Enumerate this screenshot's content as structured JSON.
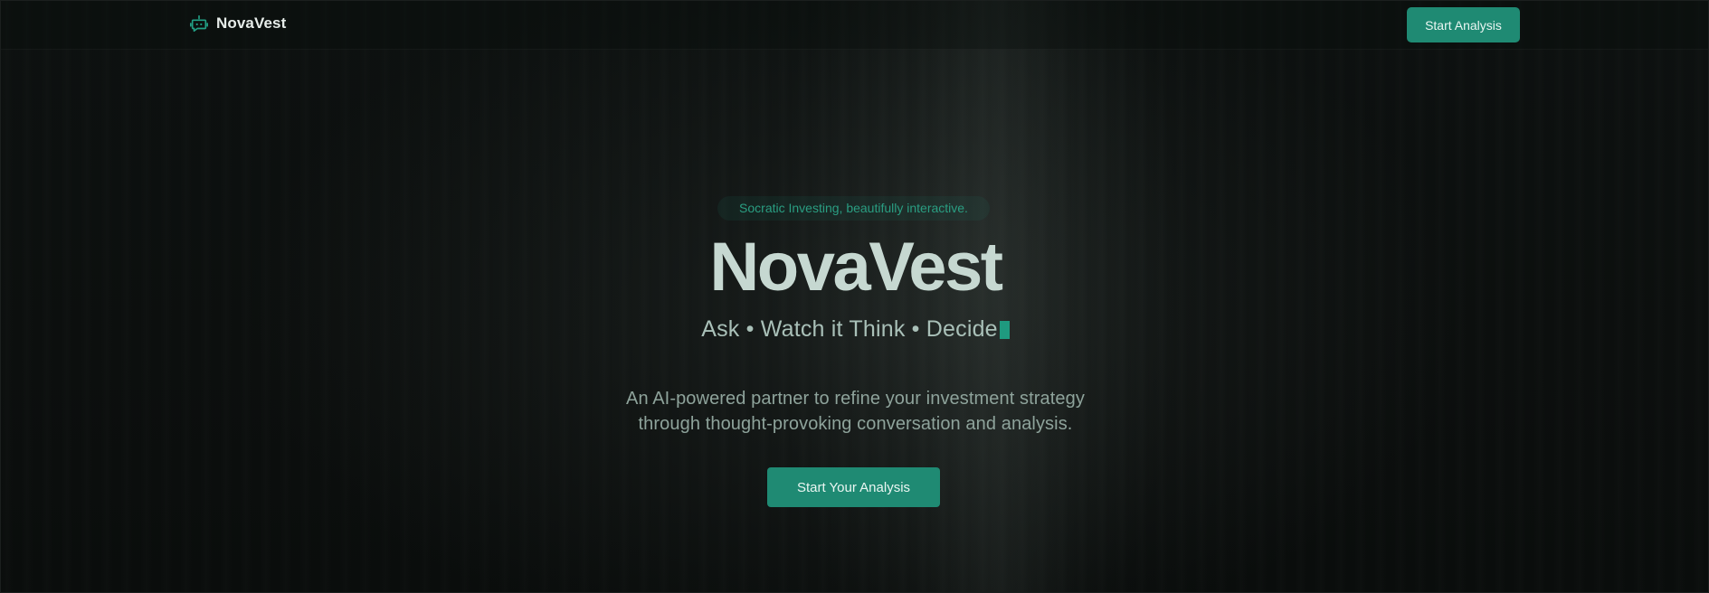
{
  "nav": {
    "brand_name": "NovaVest",
    "brand_icon": "bot-icon",
    "cta_label": "Start Analysis"
  },
  "hero": {
    "tagline": "Socratic Investing, beautifully interactive.",
    "title": "NovaVest",
    "steps_text": "Ask • Watch it Think • Decide",
    "description_line_1": "An AI-powered partner to refine your investment strategy",
    "description_line_2": "through thought-provoking conversation and analysis.",
    "cta_label": "Start Your Analysis"
  },
  "colors": {
    "background": "#0b0e0d",
    "accent": "#1f8a73",
    "title": "#c6d8d1",
    "muted_text": "#8ea39b"
  }
}
